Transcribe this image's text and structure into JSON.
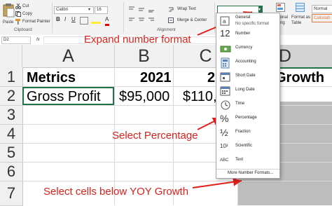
{
  "ribbon": {
    "cut": "Cut",
    "copy": "Copy",
    "format_painter": "Format Painter",
    "paste": "Paste",
    "clipboard_group": "Clipboard",
    "font_name": "Calibri",
    "font_size": "16",
    "bold": "B",
    "italic": "I",
    "underline": "U",
    "wrap_text": "Wrap Text",
    "merge_center": "Merge & Center",
    "alignment_group": "Alignment",
    "conditional": "ditional",
    "formatting": "atting",
    "format_as": "Format as",
    "table": "Table",
    "style_normal": "Normal",
    "style_calc": "Calculati"
  },
  "formula_bar": {
    "name_box": "D2",
    "fx": "fx"
  },
  "columns": [
    "A",
    "B",
    "C",
    "D"
  ],
  "rows": [
    "1",
    "2",
    "3",
    "4",
    "5",
    "6",
    "7"
  ],
  "cells": {
    "a1": "Metrics",
    "b1": "2021",
    "c1": "2",
    "d1": "Growth",
    "a2": "Gross Profit",
    "b2": "$95,000",
    "c2": "$110,0"
  },
  "dropdown": {
    "items": [
      {
        "label": "General",
        "sub": "No specific format",
        "icon": "general-icon"
      },
      {
        "label": "Number",
        "icon": "number-icon"
      },
      {
        "label": "Currency",
        "icon": "currency-icon"
      },
      {
        "label": "Accounting",
        "icon": "accounting-icon"
      },
      {
        "label": "Short Date",
        "icon": "short-date-icon"
      },
      {
        "label": "Long Date",
        "icon": "long-date-icon"
      },
      {
        "label": "Time",
        "icon": "time-icon"
      },
      {
        "label": "Percentage",
        "icon": "percentage-icon"
      },
      {
        "label": "Fraction",
        "icon": "fraction-icon"
      },
      {
        "label": "Scientific",
        "icon": "scientific-icon"
      },
      {
        "label": "Text",
        "icon": "text-icon"
      }
    ],
    "number_glyph": "12",
    "percent_glyph": "%",
    "fraction_glyph": "½",
    "scientific_glyph": "10²",
    "text_glyph": "ABC",
    "more": "More Number Formats..."
  },
  "annotations": {
    "expand": "Expand number format",
    "select_pct": "Select Percentage",
    "select_cells": "Select cells below YOY Growth"
  },
  "colors": {
    "annotation": "#e0201b",
    "excel_green": "#217346",
    "selection_gray": "#bdbdbd"
  }
}
